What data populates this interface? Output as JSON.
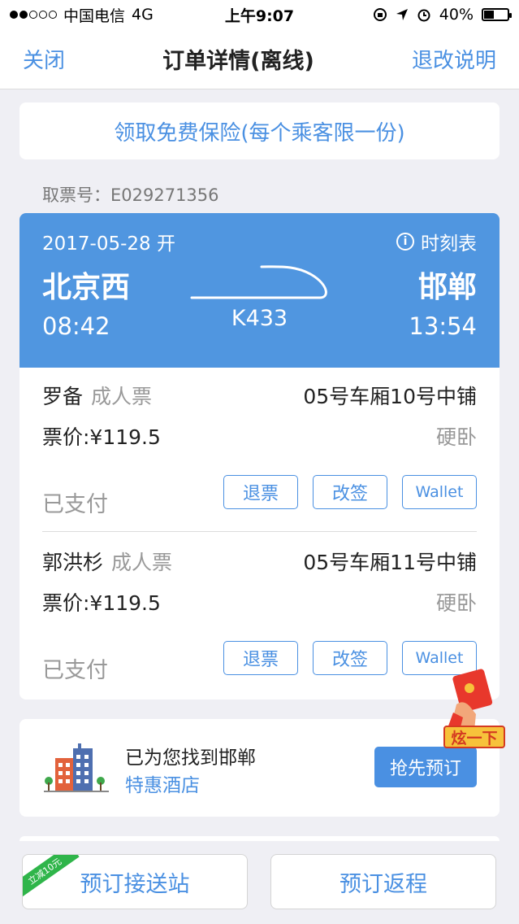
{
  "status_bar": {
    "carrier": "中国电信",
    "network": "4G",
    "time": "上午9:07",
    "battery": "40%",
    "battery_level": 0.4
  },
  "nav": {
    "close": "关闭",
    "title": "订单详情(离线)",
    "refund_info": "退改说明"
  },
  "insurance_banner": "领取免费保险(每个乘客限一份)",
  "pickup_number": "取票号：E029271356",
  "train": {
    "date": "2017-05-28 开",
    "timetable": "时刻表",
    "from_station": "北京西",
    "to_station": "邯郸",
    "depart_time": "08:42",
    "arrive_time": "13:54",
    "train_number": "K433"
  },
  "passengers": [
    {
      "name": "罗备",
      "ticket_type": "成人票",
      "seat": "05号车厢10号中铺",
      "price": "票价:¥119.5",
      "seat_class": "硬卧",
      "status": "已支付",
      "refund": "退票",
      "change": "改签",
      "wallet": "Wallet"
    },
    {
      "name": "郭洪杉",
      "ticket_type": "成人票",
      "seat": "05号车厢11号中铺",
      "price": "票价:¥119.5",
      "seat_class": "硬卧",
      "status": "已支付",
      "refund": "退票",
      "change": "改签",
      "wallet": "Wallet"
    }
  ],
  "hotel": {
    "title": "已为您找到邯郸",
    "subtitle": "特惠酒店",
    "button": "抢先预订"
  },
  "promo": {
    "label": "炫一下"
  },
  "bottom": {
    "ribbon": "立减10元",
    "shuttle": "预订接送站",
    "return_trip": "预订返程"
  },
  "colors": {
    "accent": "#4a90e2",
    "header_blue": "#5096e0",
    "ribbon_green": "#2fb54a"
  }
}
